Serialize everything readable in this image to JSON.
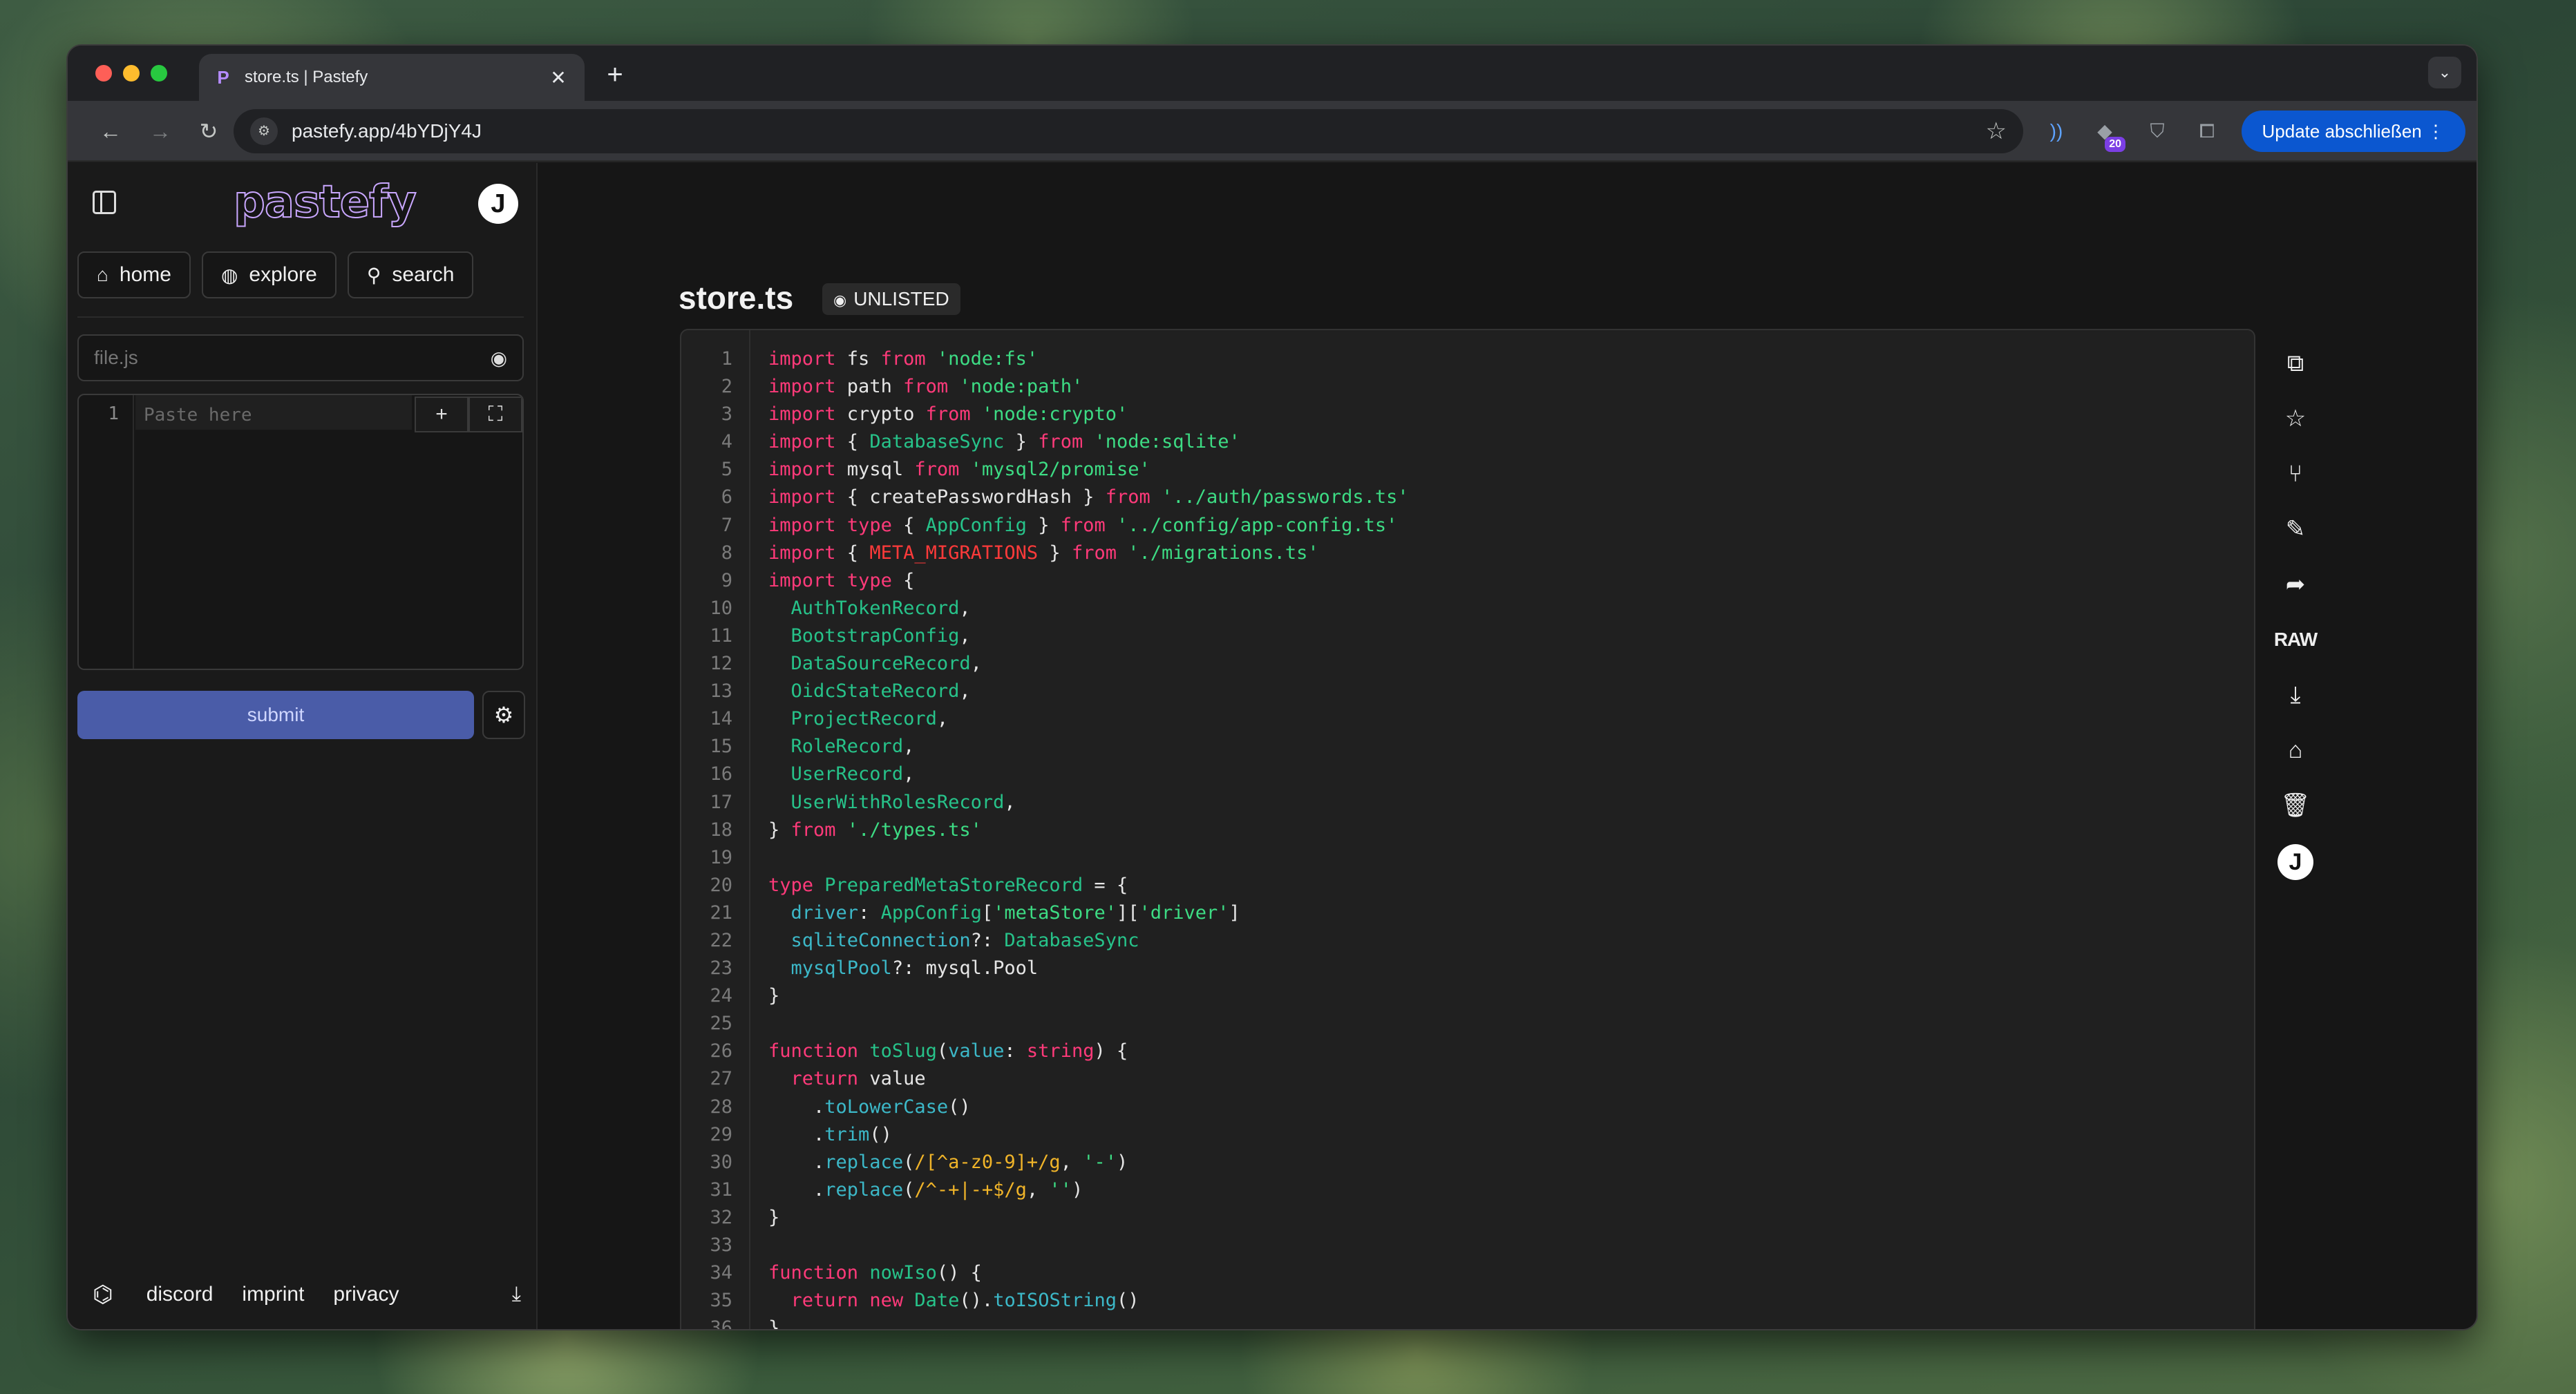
{
  "browser": {
    "tab_title": "store.ts | Pastefy",
    "tab_icon": "P",
    "url": "pastefy.app/4bYDjY4J",
    "update_label": "Update abschließen",
    "extension_badge": "20",
    "profile_initial": "J"
  },
  "sidebar": {
    "logo": "pastefy",
    "avatar_initial": "J",
    "nav": [
      {
        "label": "home"
      },
      {
        "label": "explore"
      },
      {
        "label": "search"
      }
    ],
    "filename_placeholder": "file.js",
    "editor_line_number": "1",
    "editor_placeholder": "Paste here",
    "submit_label": "submit",
    "footer_links": [
      "discord",
      "imprint",
      "privacy"
    ]
  },
  "paste": {
    "title": "store.ts",
    "visibility": "UNLISTED",
    "lines": [
      [
        [
          "kw",
          "import"
        ],
        [
          "t",
          " fs "
        ],
        [
          "kw",
          "from"
        ],
        [
          "t",
          " "
        ],
        [
          "str",
          "'node:fs'"
        ]
      ],
      [
        [
          "kw",
          "import"
        ],
        [
          "t",
          " path "
        ],
        [
          "kw",
          "from"
        ],
        [
          "t",
          " "
        ],
        [
          "str",
          "'node:path'"
        ]
      ],
      [
        [
          "kw",
          "import"
        ],
        [
          "t",
          " crypto "
        ],
        [
          "kw",
          "from"
        ],
        [
          "t",
          " "
        ],
        [
          "str",
          "'node:crypto'"
        ]
      ],
      [
        [
          "kw",
          "import"
        ],
        [
          "t",
          " { "
        ],
        [
          "ty",
          "DatabaseSync"
        ],
        [
          "t",
          " } "
        ],
        [
          "kw",
          "from"
        ],
        [
          "t",
          " "
        ],
        [
          "str",
          "'node:sqlite'"
        ]
      ],
      [
        [
          "kw",
          "import"
        ],
        [
          "t",
          " mysql "
        ],
        [
          "kw",
          "from"
        ],
        [
          "t",
          " "
        ],
        [
          "str",
          "'mysql2/promise'"
        ]
      ],
      [
        [
          "kw",
          "import"
        ],
        [
          "t",
          " { createPasswordHash } "
        ],
        [
          "kw",
          "from"
        ],
        [
          "t",
          " "
        ],
        [
          "str",
          "'../auth/passwords.ts'"
        ]
      ],
      [
        [
          "kw",
          "import"
        ],
        [
          "t",
          " "
        ],
        [
          "kw",
          "type"
        ],
        [
          "t",
          " { "
        ],
        [
          "ty",
          "AppConfig"
        ],
        [
          "t",
          " } "
        ],
        [
          "kw",
          "from"
        ],
        [
          "t",
          " "
        ],
        [
          "str",
          "'../config/app-config.ts'"
        ]
      ],
      [
        [
          "kw",
          "import"
        ],
        [
          "t",
          " { "
        ],
        [
          "const",
          "META_MIGRATIONS"
        ],
        [
          "t",
          " } "
        ],
        [
          "kw",
          "from"
        ],
        [
          "t",
          " "
        ],
        [
          "str",
          "'./migrations.ts'"
        ]
      ],
      [
        [
          "kw",
          "import"
        ],
        [
          "t",
          " "
        ],
        [
          "kw",
          "type"
        ],
        [
          "t",
          " {"
        ]
      ],
      [
        [
          "t",
          "  "
        ],
        [
          "ty",
          "AuthTokenRecord"
        ],
        [
          "t",
          ","
        ]
      ],
      [
        [
          "t",
          "  "
        ],
        [
          "ty",
          "BootstrapConfig"
        ],
        [
          "t",
          ","
        ]
      ],
      [
        [
          "t",
          "  "
        ],
        [
          "ty",
          "DataSourceRecord"
        ],
        [
          "t",
          ","
        ]
      ],
      [
        [
          "t",
          "  "
        ],
        [
          "ty",
          "OidcStateRecord"
        ],
        [
          "t",
          ","
        ]
      ],
      [
        [
          "t",
          "  "
        ],
        [
          "ty",
          "ProjectRecord"
        ],
        [
          "t",
          ","
        ]
      ],
      [
        [
          "t",
          "  "
        ],
        [
          "ty",
          "RoleRecord"
        ],
        [
          "t",
          ","
        ]
      ],
      [
        [
          "t",
          "  "
        ],
        [
          "ty",
          "UserRecord"
        ],
        [
          "t",
          ","
        ]
      ],
      [
        [
          "t",
          "  "
        ],
        [
          "ty",
          "UserWithRolesRecord"
        ],
        [
          "t",
          ","
        ]
      ],
      [
        [
          "t",
          "} "
        ],
        [
          "kw",
          "from"
        ],
        [
          "t",
          " "
        ],
        [
          "str",
          "'./types.ts'"
        ]
      ],
      [],
      [
        [
          "kw",
          "type"
        ],
        [
          "t",
          " "
        ],
        [
          "ty",
          "PreparedMetaStoreRecord"
        ],
        [
          "t",
          " = {"
        ]
      ],
      [
        [
          "t",
          "  "
        ],
        [
          "fn",
          "driver"
        ],
        [
          "t",
          ": "
        ],
        [
          "ty",
          "AppConfig"
        ],
        [
          "t",
          "["
        ],
        [
          "str",
          "'metaStore'"
        ],
        [
          "t",
          "]["
        ],
        [
          "str",
          "'driver'"
        ],
        [
          "t",
          "]"
        ]
      ],
      [
        [
          "t",
          "  "
        ],
        [
          "fn",
          "sqliteConnection"
        ],
        [
          "t",
          "?: "
        ],
        [
          "ty",
          "DatabaseSync"
        ]
      ],
      [
        [
          "t",
          "  "
        ],
        [
          "fn",
          "mysqlPool"
        ],
        [
          "t",
          "?: mysql.Pool"
        ]
      ],
      [
        [
          "t",
          "}"
        ]
      ],
      [],
      [
        [
          "kw",
          "function"
        ],
        [
          "t",
          " "
        ],
        [
          "ty",
          "toSlug"
        ],
        [
          "t",
          "("
        ],
        [
          "fn",
          "value"
        ],
        [
          "t",
          ": "
        ],
        [
          "kw",
          "string"
        ],
        [
          "t",
          ") {"
        ]
      ],
      [
        [
          "t",
          "  "
        ],
        [
          "kw",
          "return"
        ],
        [
          "t",
          " value"
        ]
      ],
      [
        [
          "t",
          "    ."
        ],
        [
          "fn",
          "toLowerCase"
        ],
        [
          "t",
          "()"
        ]
      ],
      [
        [
          "t",
          "    ."
        ],
        [
          "fn",
          "trim"
        ],
        [
          "t",
          "()"
        ]
      ],
      [
        [
          "t",
          "    ."
        ],
        [
          "fn",
          "replace"
        ],
        [
          "t",
          "("
        ],
        [
          "re",
          "/[^a-z0-9]+/g"
        ],
        [
          "t",
          ", "
        ],
        [
          "str",
          "'-'"
        ],
        [
          "t",
          ")"
        ]
      ],
      [
        [
          "t",
          "    ."
        ],
        [
          "fn",
          "replace"
        ],
        [
          "t",
          "("
        ],
        [
          "re",
          "/^-+|-+$/g"
        ],
        [
          "t",
          ", "
        ],
        [
          "str",
          "''"
        ],
        [
          "t",
          ")"
        ]
      ],
      [
        [
          "t",
          "}"
        ]
      ],
      [],
      [
        [
          "kw",
          "function"
        ],
        [
          "t",
          " "
        ],
        [
          "ty",
          "nowIso"
        ],
        [
          "t",
          "() {"
        ]
      ],
      [
        [
          "t",
          "  "
        ],
        [
          "kw",
          "return"
        ],
        [
          "t",
          " "
        ],
        [
          "kw",
          "new"
        ],
        [
          "t",
          " "
        ],
        [
          "ty",
          "Date"
        ],
        [
          "t",
          "()."
        ],
        [
          "fn",
          "toISOString"
        ],
        [
          "t",
          "()"
        ]
      ],
      [
        [
          "t",
          "}"
        ]
      ]
    ]
  },
  "actions": [
    {
      "name": "copy-icon",
      "glyph": "⧉"
    },
    {
      "name": "star-icon",
      "glyph": "☆"
    },
    {
      "name": "fork-icon",
      "glyph": "⑂"
    },
    {
      "name": "edit-pencil-icon",
      "glyph": "✎"
    },
    {
      "name": "share-icon",
      "glyph": "➦"
    },
    {
      "name": "raw-button",
      "glyph": "RAW"
    },
    {
      "name": "download-icon",
      "glyph": "⤓"
    },
    {
      "name": "tag-icon",
      "glyph": "⌂"
    },
    {
      "name": "trash-icon",
      "glyph": "🗑"
    },
    {
      "name": "user-avatar",
      "glyph": "J"
    }
  ]
}
